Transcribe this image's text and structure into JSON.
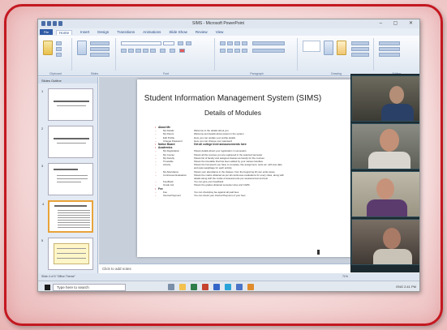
{
  "app": {
    "title": "SIMS - Microsoft PowerPoint",
    "file_tab": "File",
    "tabs": [
      "Home",
      "Insert",
      "Design",
      "Transitions",
      "Animations",
      "Slide Show",
      "Review",
      "View"
    ],
    "active_tab": "Home",
    "window_controls": "– ▢ ✕"
  },
  "ribbon": {
    "groups": [
      "Clipboard",
      "Slides",
      "Font",
      "Paragraph",
      "Drawing",
      "Editing"
    ]
  },
  "thumbnail_pane": {
    "tabs": "Slides   Outline",
    "slide_numbers": [
      "1",
      "2",
      "3",
      "4",
      "5"
    ],
    "selected_slide": 4
  },
  "slide": {
    "title": "Student Information Management System (SIMS)",
    "subtitle": "Details of Modules",
    "rows": [
      {
        "type": "h",
        "key": "About Me",
        "val": ""
      },
      {
        "type": "sub",
        "key": "My Details",
        "val": "Welcome to the details about you"
      },
      {
        "type": "sub",
        "key": "My Parent",
        "val": "Welcome and details about parent in the system"
      },
      {
        "type": "sub",
        "key": "Edit Profile",
        "val": "Here you can update your profile details"
      },
      {
        "type": "sub",
        "key": "Change Password",
        "val": "Here you can change your password"
      },
      {
        "type": "h",
        "key": "Notice Board",
        "val": "Get all college level announcements here"
      },
      {
        "type": "h",
        "key": "Academics",
        "val": ""
      },
      {
        "type": "sub",
        "key": "My Registration",
        "val": "Shows details about your registration in semesters"
      },
      {
        "type": "sub",
        "key": "My Course",
        "val": "Shows all the courses you are registered in the selected semester"
      },
      {
        "type": "sub",
        "key": "My Faculty",
        "val": "Shows list of faculty and assigned classes as faculty for the courses"
      },
      {
        "type": "sub",
        "key": "Timetable",
        "val": "Shows the timetable that has been added by your various faculties"
      },
      {
        "type": "sub",
        "key": "Activity",
        "val": "Shows the homework you have to complete, like assignment, tests etc. with due date"
      },
      {
        "type": "sub",
        "key": "",
        "val": "and pass-weightage for each activity"
      },
      {
        "type": "sub",
        "key": "My Attendance",
        "val": "Shows your attendance in the classes, from the beginning till your entire leave"
      },
      {
        "type": "sub",
        "key": "Continuous Evaluation",
        "val": "Shows the marks obtained as per all continuous evaluations for every class, along with"
      },
      {
        "type": "sub",
        "key": "",
        "val": "details along with the marks of assessments per sessional test and test"
      },
      {
        "type": "sub",
        "key": "Feedback",
        "val": "You can give your Feedback"
      },
      {
        "type": "sub",
        "key": "Grade List",
        "val": "Shows the grades obtained semester wise and CGPA"
      },
      {
        "type": "h",
        "key": "Fee",
        "val": ""
      },
      {
        "type": "sub",
        "key": "Fee",
        "val": "You can check/pay fee against all paid fees"
      },
      {
        "type": "sub",
        "key": "Internal Payment",
        "val": "You can check your internal Payment of your fees"
      }
    ]
  },
  "notes": {
    "placeholder": "Click to add notes"
  },
  "status": {
    "left": "Slide 4 of 5   \"Office Theme\"",
    "zoom": "71%"
  },
  "taskbar": {
    "search_placeholder": "Type here to search",
    "tray_time": "ENG  2:41 PM"
  }
}
